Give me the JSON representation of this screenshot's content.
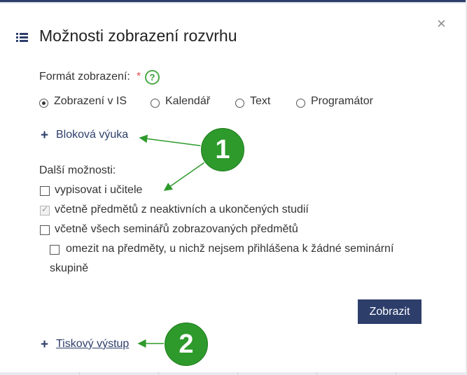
{
  "dialog": {
    "title": "Možnosti zobrazení rozvrhu",
    "close_glyph": "×",
    "title_icon": "list-icon"
  },
  "format": {
    "label": "Formát zobrazení:",
    "required_mark": "*",
    "help_glyph": "?",
    "options": [
      {
        "label": "Zobrazení v IS",
        "selected": true
      },
      {
        "label": "Kalendář",
        "selected": false
      },
      {
        "label": "Text",
        "selected": false
      },
      {
        "label": "Programátor",
        "selected": false
      }
    ]
  },
  "block_teaching": {
    "plus": "+",
    "label": "Bloková výuka"
  },
  "more_options": {
    "label": "Další možnosti:",
    "checkboxes": [
      {
        "label": "vypisovat i učitele",
        "checked": false,
        "disabled": false
      },
      {
        "label": "včetně předmětů z neaktivních a ukončených studií",
        "checked": true,
        "disabled": true
      },
      {
        "label": "včetně všech seminářů zobrazovaných předmětů",
        "checked": false,
        "disabled": false
      },
      {
        "label_line1": "omezit na předměty, u nichž nejsem přihlášena k žádné seminární",
        "label_line2": "skupině",
        "checked": false,
        "disabled": false
      }
    ]
  },
  "submit_button": {
    "label": "Zobrazit"
  },
  "print_output": {
    "plus": "+",
    "label": "Tiskový výstup"
  },
  "annotations": [
    {
      "number": "1"
    },
    {
      "number": "2"
    }
  ],
  "colors": {
    "primary": "#2d3e6b",
    "annotation_green": "#2e9a2c",
    "required_red": "#d9534f",
    "help_green": "#4caa47"
  }
}
